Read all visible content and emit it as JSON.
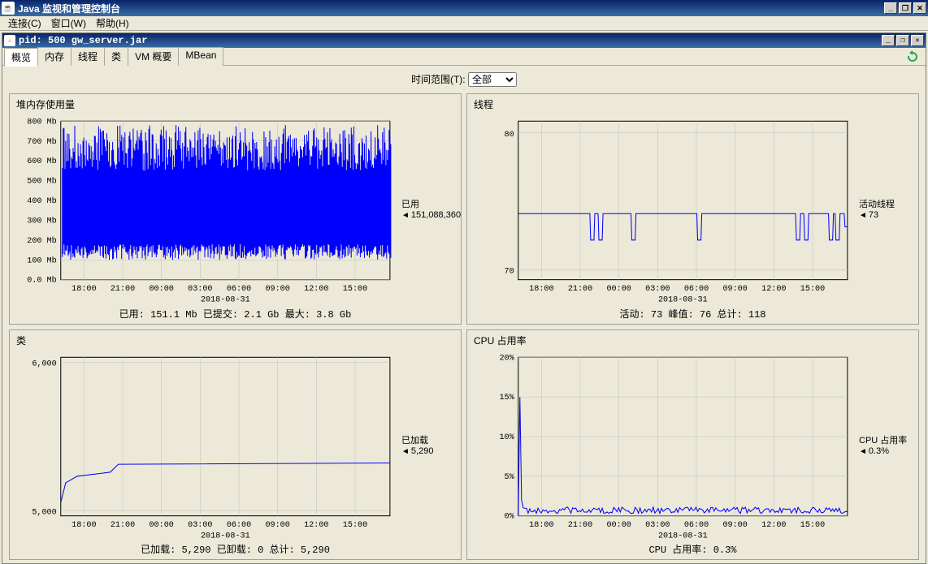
{
  "window": {
    "title": "Java 监视和管理控制台",
    "menu": {
      "connect": "连接(C)",
      "window": "窗口(W)",
      "help": "帮助(H)"
    }
  },
  "inner_window": {
    "title": "pid: 500 gw_server.jar"
  },
  "tabs": {
    "overview": "概览",
    "memory": "内存",
    "threads": "线程",
    "classes": "类",
    "vm_summary": "VM 概要",
    "mbean": "MBean"
  },
  "time_range": {
    "label": "时间范围(T):",
    "selected": "全部"
  },
  "charts": {
    "heap": {
      "title": "堆内存使用量",
      "side_label1": "已用",
      "side_label2": "151,088,360",
      "bottom": "已用:  151.1  Mb        已提交:    2.1  Gb        最大:    3.8  Gb"
    },
    "threads": {
      "title": "线程",
      "side_label1": "活动线程",
      "side_label2": "73",
      "bottom": "活动:   73         峰值:   76         总计:   118"
    },
    "classes": {
      "title": "类",
      "side_label1": "已加载",
      "side_label2": "5,290",
      "bottom": "已加载:   5,290        已卸载:   0        总计:   5,290"
    },
    "cpu": {
      "title": "CPU 占用率",
      "side_label1": "CPU 占用率",
      "side_label2": "0.3%",
      "bottom": "CPU 占用率:  0.3%"
    }
  },
  "chart_data": [
    {
      "type": "line",
      "title": "堆内存使用量",
      "xlabel": "2018-08-31",
      "ylabel": "Mb",
      "x_ticks": [
        "18:00",
        "21:00",
        "00:00",
        "03:00",
        "06:00",
        "09:00",
        "12:00",
        "15:00"
      ],
      "y_ticks": [
        0,
        100,
        200,
        300,
        400,
        500,
        600,
        700,
        800
      ],
      "ylim": [
        0,
        800
      ],
      "series": [
        {
          "name": "已用",
          "note": "oscillating sawtooth between ~100 and ~780 Mb across entire range, hundreds of GC cycles"
        }
      ]
    },
    {
      "type": "line",
      "title": "线程",
      "xlabel": "2018-08-31",
      "ylabel": "",
      "x_ticks": [
        "18:00",
        "21:00",
        "00:00",
        "03:00",
        "06:00",
        "09:00",
        "12:00",
        "15:00"
      ],
      "y_ticks": [
        70,
        80
      ],
      "ylim": [
        69,
        81
      ],
      "series": [
        {
          "name": "活动线程",
          "note": "steady ~74 with occasional dips to ~72, end value 73"
        }
      ]
    },
    {
      "type": "line",
      "title": "类",
      "xlabel": "2018-08-31",
      "ylabel": "",
      "x_ticks": [
        "18:00",
        "21:00",
        "00:00",
        "03:00",
        "06:00",
        "09:00",
        "12:00",
        "15:00"
      ],
      "y_ticks": [
        5000,
        6000
      ],
      "ylim": [
        4900,
        6100
      ],
      "series": [
        {
          "name": "已加载",
          "note": "starts near 5000, rises quickly to ~5200, step to ~5290 around 20:00, flat thereafter"
        }
      ]
    },
    {
      "type": "line",
      "title": "CPU 占用率",
      "xlabel": "2018-08-31",
      "ylabel": "%",
      "x_ticks": [
        "18:00",
        "21:00",
        "00:00",
        "03:00",
        "06:00",
        "09:00",
        "12:00",
        "15:00"
      ],
      "y_ticks": [
        0,
        5,
        10,
        15,
        20
      ],
      "ylim": [
        0,
        20
      ],
      "series": [
        {
          "name": "CPU 占用率",
          "note": "initial spike ~15%, then near 0.3% flat"
        }
      ]
    }
  ]
}
